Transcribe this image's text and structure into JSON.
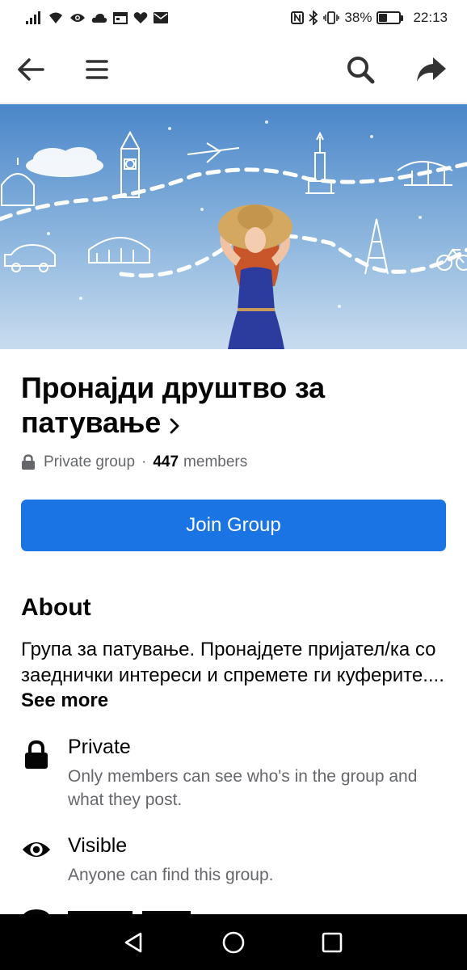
{
  "status_bar": {
    "left_icons": [
      "signal-icon",
      "wifi-icon",
      "eye-icon",
      "cloud-icon",
      "calendar-icon",
      "heart-icon",
      "mail-icon"
    ],
    "right_icons": [
      "nfc-icon",
      "bluetooth-icon",
      "vibrate-icon"
    ],
    "battery_percent": "38%",
    "battery_level": 0.38,
    "time": "22:13"
  },
  "nav": {
    "icons": [
      "back-arrow-icon",
      "menu-icon",
      "search-icon",
      "share-icon"
    ]
  },
  "group": {
    "title": "Пронајди друштво за патување",
    "privacy": "Private group",
    "separator": "·",
    "member_count": "447",
    "members_label": "members"
  },
  "join_button": {
    "label": "Join Group"
  },
  "about": {
    "heading": "About",
    "description": "Група за патување. Пронајдете пријател/ка со заеднички интереси и спремете ги куферите.... ",
    "see_more": "See more"
  },
  "info_rows": [
    {
      "icon": "lock-icon",
      "title": "Private",
      "desc": "Only members can see who's in the group and what they post."
    },
    {
      "icon": "eye-icon",
      "title": "Visible",
      "desc": "Anyone can find this group."
    }
  ],
  "colors": {
    "accent": "#1b74e4",
    "secondary_text": "#65676b",
    "primary_text": "#050505"
  }
}
